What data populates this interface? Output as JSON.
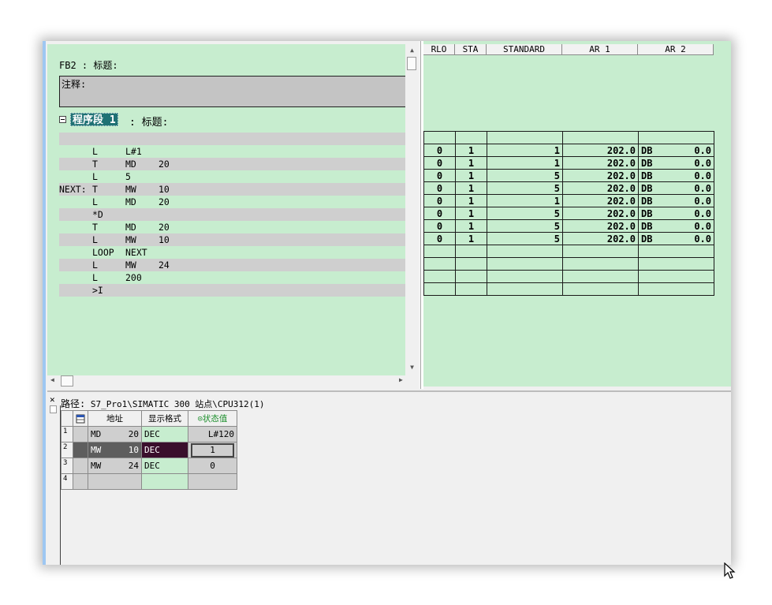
{
  "editor": {
    "block_title": "FB2 : 标题:",
    "comment_label": "注释:",
    "network_name": "程序段 1",
    "network_title": ": 标题:",
    "code": [
      {
        "label": "",
        "op": "L",
        "a1": "L#1",
        "a2": ""
      },
      {
        "label": "",
        "op": "T",
        "a1": "MD",
        "a2": "20"
      },
      {
        "label": "",
        "op": "L",
        "a1": "5",
        "a2": ""
      },
      {
        "label": "NEXT:",
        "op": "T",
        "a1": "MW",
        "a2": "10"
      },
      {
        "label": "",
        "op": "L",
        "a1": "MD",
        "a2": "20"
      },
      {
        "label": "",
        "op": "*D",
        "a1": "",
        "a2": ""
      },
      {
        "label": "",
        "op": "T",
        "a1": "MD",
        "a2": "20"
      },
      {
        "label": "",
        "op": "L",
        "a1": "MW",
        "a2": "10"
      },
      {
        "label": "",
        "op": "LOOP",
        "a1": "NEXT",
        "a2": ""
      },
      {
        "label": "",
        "op": "L",
        "a1": "MW",
        "a2": "24"
      },
      {
        "label": "",
        "op": "L",
        "a1": "200",
        "a2": ""
      },
      {
        "label": "",
        "op": ">I",
        "a1": "",
        "a2": ""
      }
    ]
  },
  "status_pane": {
    "columns": [
      "RLO",
      "STA",
      "STANDARD",
      "AR 1",
      "AR 2"
    ],
    "rows": [
      {
        "rlo": "0",
        "sta": "1",
        "standard": "1",
        "ar1": "202.0",
        "ar2_db": "DB",
        "ar2_val": "0.0"
      },
      {
        "rlo": "0",
        "sta": "1",
        "standard": "1",
        "ar1": "202.0",
        "ar2_db": "DB",
        "ar2_val": "0.0"
      },
      {
        "rlo": "0",
        "sta": "1",
        "standard": "5",
        "ar1": "202.0",
        "ar2_db": "DB",
        "ar2_val": "0.0"
      },
      {
        "rlo": "0",
        "sta": "1",
        "standard": "5",
        "ar1": "202.0",
        "ar2_db": "DB",
        "ar2_val": "0.0"
      },
      {
        "rlo": "0",
        "sta": "1",
        "standard": "1",
        "ar1": "202.0",
        "ar2_db": "DB",
        "ar2_val": "0.0"
      },
      {
        "rlo": "0",
        "sta": "1",
        "standard": "5",
        "ar1": "202.0",
        "ar2_db": "DB",
        "ar2_val": "0.0"
      },
      {
        "rlo": "0",
        "sta": "1",
        "standard": "5",
        "ar1": "202.0",
        "ar2_db": "DB",
        "ar2_val": "0.0"
      },
      {
        "rlo": "0",
        "sta": "1",
        "standard": "5",
        "ar1": "202.0",
        "ar2_db": "DB",
        "ar2_val": "0.0"
      }
    ]
  },
  "variable_table": {
    "path_label": "路径:",
    "path_value": "S7_Pro1\\SIMATIC 300 站点\\CPU312(1)",
    "headers": {
      "address": "地址",
      "format": "显示格式",
      "status": "状态值"
    },
    "rows": [
      {
        "no": "1",
        "area": "MD",
        "addr": "20",
        "format": "DEC",
        "value": "L#120"
      },
      {
        "no": "2",
        "area": "MW",
        "addr": "10",
        "format": "DEC",
        "value": "1"
      },
      {
        "no": "3",
        "area": "MW",
        "addr": "24",
        "format": "DEC",
        "value": "0"
      },
      {
        "no": "4",
        "area": "",
        "addr": "",
        "format": "",
        "value": ""
      }
    ]
  },
  "colors": {
    "editor_bg": "#c7edcf",
    "row_gray": "#cfcfcf",
    "network_highlight": "#1f7174",
    "selected_format": "#3a0f2c"
  }
}
